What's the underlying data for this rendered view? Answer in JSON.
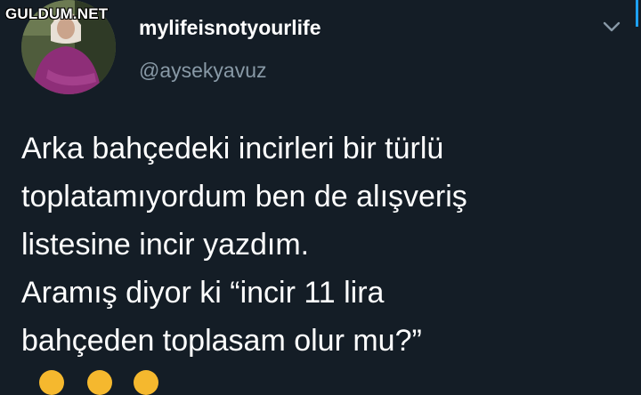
{
  "watermark": {
    "text": "GULDUM.NET"
  },
  "profile": {
    "display_name": "mylifeisnotyourlife",
    "handle": "@aysekyavuz"
  },
  "tweet": {
    "lines": [
      "Arka bahçedeki incirleri bir türlü",
      "toplatamıyordum ben de alışveriş",
      "listesine incir yazdım.",
      "Aramış diyor ki “incir 11 lira",
      "bahçeden toplasam olur mu?”"
    ]
  },
  "icons": {
    "menu": "chevron-down-icon",
    "emoji": "face-with-tears-of-joy-icon"
  },
  "colors": {
    "background": "#141d26",
    "text": "#ffffff",
    "muted": "#8899a6",
    "accent": "#1da1f2"
  }
}
